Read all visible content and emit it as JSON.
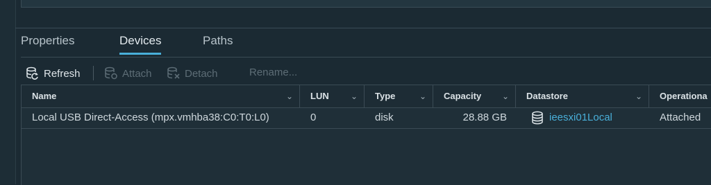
{
  "tabs": [
    {
      "label": "Properties",
      "active": false
    },
    {
      "label": "Devices",
      "active": true
    },
    {
      "label": "Paths",
      "active": false
    }
  ],
  "toolbar": {
    "refresh": "Refresh",
    "attach": "Attach",
    "detach": "Detach",
    "rename": "Rename..."
  },
  "columns": [
    "Name",
    "LUN",
    "Type",
    "Capacity",
    "Datastore",
    "Operationa"
  ],
  "rows": [
    {
      "name": "Local USB Direct-Access (mpx.vmhba38:C0:T0:L0)",
      "lun": "0",
      "type": "disk",
      "capacity": "28.88 GB",
      "datastore": "ieesxi01Local",
      "operational": "Attached"
    }
  ],
  "colors": {
    "background": "#1b2a33",
    "accent": "#49afd9",
    "disabled": "#5d6d76"
  },
  "icons": {
    "refresh": "database-refresh-icon",
    "attach": "database-attach-icon",
    "detach": "database-detach-icon",
    "datastore": "database-icon",
    "column_menu": "chevron-down-icon"
  }
}
